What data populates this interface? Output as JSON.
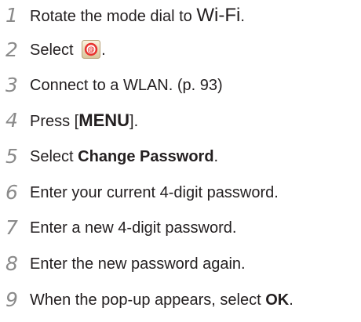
{
  "steps": [
    {
      "number": "1",
      "text_before": "Rotate the mode dial to ",
      "emphasis": "Wi-Fi",
      "text_after": "."
    },
    {
      "number": "2",
      "text_before": "Select ",
      "icon": "email-icon",
      "text_after": "."
    },
    {
      "number": "3",
      "text": "Connect to a WLAN. (p. 93)"
    },
    {
      "number": "4",
      "text_before": "Press [",
      "emphasis": "MENU",
      "text_after": "]."
    },
    {
      "number": "5",
      "text_before": "Select ",
      "bold": "Change Password",
      "text_after": "."
    },
    {
      "number": "6",
      "text": "Enter your current 4-digit password."
    },
    {
      "number": "7",
      "text": "Enter a new 4-digit password."
    },
    {
      "number": "8",
      "text": "Enter the new password again."
    },
    {
      "number": "9",
      "text_before": "When the pop-up appears, select ",
      "bold": "OK",
      "text_after": "."
    }
  ],
  "colors": {
    "step_number": "#8a8a8a",
    "text": "#231f20",
    "icon_red": "#e8322f",
    "icon_tile": "#f2e3c4"
  }
}
